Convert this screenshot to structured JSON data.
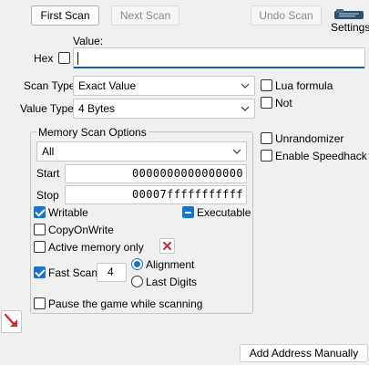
{
  "toolbar": {
    "first_scan": "First Scan",
    "next_scan": "Next Scan",
    "undo_scan": "Undo Scan",
    "settings": "Settings"
  },
  "value": {
    "label": "Value:",
    "hex_label": "Hex",
    "hex_checked": false,
    "input_value": ""
  },
  "scan_type": {
    "label": "Scan Type",
    "selected": "Exact Value"
  },
  "value_type": {
    "label": "Value Type",
    "selected": "4 Bytes"
  },
  "right_options": {
    "lua_formula": "Lua formula",
    "not": "Not",
    "unrandomizer": "Unrandomizer",
    "enable_speedhack": "Enable Speedhack"
  },
  "memory": {
    "title": "Memory Scan Options",
    "region_selected": "All",
    "start_label": "Start",
    "start_value": "0000000000000000",
    "stop_label": "Stop",
    "stop_value": "00007fffffffffff",
    "writable": "Writable",
    "executable": "Executable",
    "copy_on_write": "CopyOnWrite",
    "active_memory_only": "Active memory only",
    "fast_scan": "Fast Scan",
    "fast_scan_value": "4",
    "alignment": "Alignment",
    "last_digits": "Last Digits",
    "pause_game": "Pause the game while scanning"
  },
  "bottom": {
    "add_address": "Add Address Manually"
  },
  "colors": {
    "accent": "#1a73c9",
    "clear_red": "#d9232e",
    "arrow_red": "#d42a2a"
  }
}
